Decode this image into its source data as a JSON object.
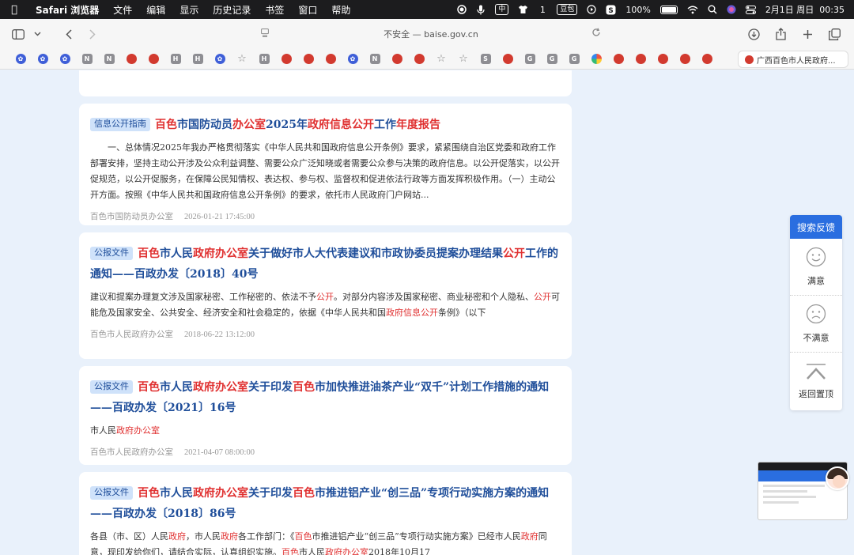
{
  "menubar": {
    "app": "Safari 浏览器",
    "items": [
      "文件",
      "编辑",
      "显示",
      "历史记录",
      "书签",
      "窗口",
      "帮助"
    ],
    "ime": "中",
    "counter": "1",
    "doubao": "豆包",
    "battery": "100%",
    "datetime": "2月1日 周日  00:35"
  },
  "toolbar": {
    "url": "不安全 — baise.gov.cn"
  },
  "favorites": {
    "items": [
      {
        "icon": "paw"
      },
      {
        "icon": "paw"
      },
      {
        "icon": "paw"
      },
      {
        "icon": "gray",
        "letter": "N"
      },
      {
        "icon": "gray",
        "letter": "N"
      },
      {
        "icon": "red"
      },
      {
        "icon": "red"
      },
      {
        "icon": "gray",
        "letter": "H"
      },
      {
        "icon": "gray",
        "letter": "H"
      },
      {
        "icon": "paw"
      },
      {
        "icon": "star"
      },
      {
        "icon": "gray",
        "letter": "H"
      },
      {
        "icon": "red"
      },
      {
        "icon": "red"
      },
      {
        "icon": "red"
      },
      {
        "icon": "paw"
      },
      {
        "icon": "gray",
        "letter": "N"
      },
      {
        "icon": "red"
      },
      {
        "icon": "red"
      },
      {
        "icon": "star"
      },
      {
        "icon": "star"
      },
      {
        "icon": "gray",
        "letter": "S"
      },
      {
        "icon": "red"
      },
      {
        "icon": "gray",
        "letter": "G"
      },
      {
        "icon": "gray",
        "letter": "G"
      },
      {
        "icon": "gray",
        "letter": "G"
      },
      {
        "icon": "multi"
      },
      {
        "icon": "red"
      },
      {
        "icon": "red"
      },
      {
        "icon": "red"
      },
      {
        "icon": "red"
      },
      {
        "icon": "red"
      }
    ],
    "active_tab": "广西百色市人民政府..."
  },
  "results": [
    {
      "tag": "信息公开指南",
      "title_parts": [
        {
          "t": "百色",
          "h": true
        },
        {
          "t": "市国防动员",
          "h": false
        },
        {
          "t": "办公室",
          "h": true
        },
        {
          "t": "2025年",
          "h": false
        },
        {
          "t": "政府信息公开",
          "h": true
        },
        {
          "t": "工作",
          "h": false
        },
        {
          "t": "年度报告",
          "h": true
        }
      ],
      "snippet_parts": [
        {
          "t": "　　一、总体情况2025年我办严格贯彻落实《中华人民共和国政府信息公开条例》要求，紧紧围绕自治区党委和政府工作部署安排，坚持主动公开涉及公众利益调整、需要公众广泛知晓或者需要公众参与决策的政府信息。以公开促落实，以公开促规范，以公开促服务，在保障公民知情权、表达权、参与权、监督权和促进依法行政等方面发挥积极作用。（一）主动公开方面。按照《中华人民共和国政府信息公开条例》的要求，依托市人民政府门户网站...",
          "h": false
        }
      ],
      "source": "百色市国防动员办公室",
      "date": "2026-01-21 17:45:00"
    },
    {
      "tag": "公报文件",
      "title_parts": [
        {
          "t": "百色",
          "h": true
        },
        {
          "t": "市人民",
          "h": false
        },
        {
          "t": "政府办公室",
          "h": true
        },
        {
          "t": "关于做好市人大代表建议和市政协委员提案办理结果",
          "h": false
        },
        {
          "t": "公开",
          "h": true
        },
        {
          "t": "工作的通知——百政办发〔2018〕40号",
          "h": false
        }
      ],
      "snippet_parts": [
        {
          "t": "建议和提案办理复文涉及国家秘密、工作秘密的、依法不予",
          "h": false
        },
        {
          "t": "公开",
          "h": true
        },
        {
          "t": "。对部分内容涉及国家秘密、商业秘密和个人隐私、",
          "h": false
        },
        {
          "t": "公开",
          "h": true
        },
        {
          "t": "可能危及国家安全、公共安全、经济安全和社会稳定的，依据《中华人民共和国",
          "h": false
        },
        {
          "t": "政府信息公开",
          "h": true
        },
        {
          "t": "条例》（以下",
          "h": false
        }
      ],
      "source": "百色市人民政府办公室",
      "date": "2018-06-22 13:12:00"
    },
    {
      "tag": "公报文件",
      "title_parts": [
        {
          "t": "百色",
          "h": true
        },
        {
          "t": "市人民",
          "h": false
        },
        {
          "t": "政府办公室",
          "h": true
        },
        {
          "t": "关于印发",
          "h": false
        },
        {
          "t": "百色",
          "h": true
        },
        {
          "t": "市加快推进油茶产业“双千”计划工作措施的通知——百政办发〔2021〕16号",
          "h": false
        }
      ],
      "snippet_parts": [
        {
          "t": "市人民",
          "h": false
        },
        {
          "t": "政府办公室",
          "h": true
        }
      ],
      "source": "百色市人民政府办公室",
      "date": "2021-04-07 08:00:00"
    },
    {
      "tag": "公报文件",
      "title_parts": [
        {
          "t": "百色",
          "h": true
        },
        {
          "t": "市人民",
          "h": false
        },
        {
          "t": "政府办公室",
          "h": true
        },
        {
          "t": "关于印发",
          "h": false
        },
        {
          "t": "百色",
          "h": true
        },
        {
          "t": "市推进铝产业“创三品”专项行动实施方案的通知——百政办发〔2018〕86号",
          "h": false
        }
      ],
      "snippet_parts": [
        {
          "t": "各县（市、区）人民",
          "h": false
        },
        {
          "t": "政府",
          "h": true
        },
        {
          "t": "，市人民",
          "h": false
        },
        {
          "t": "政府",
          "h": true
        },
        {
          "t": "各工作部门：《",
          "h": false
        },
        {
          "t": "百色",
          "h": true
        },
        {
          "t": "市推进铝产业“创三品”专项行动实施方案》已经市人民",
          "h": false
        },
        {
          "t": "政府",
          "h": true
        },
        {
          "t": "同意，现印发给你们，请结合实际，认真组织实施。",
          "h": false
        },
        {
          "t": "百色",
          "h": true
        },
        {
          "t": "市人民",
          "h": false
        },
        {
          "t": "政府办公室",
          "h": true
        },
        {
          "t": "2018年10月17",
          "h": false
        }
      ],
      "source": "",
      "date": ""
    }
  ],
  "feedback": {
    "title": "搜索反馈",
    "satisfied": "满意",
    "unsatisfied": "不满意",
    "back_to_top": "返回置顶"
  }
}
